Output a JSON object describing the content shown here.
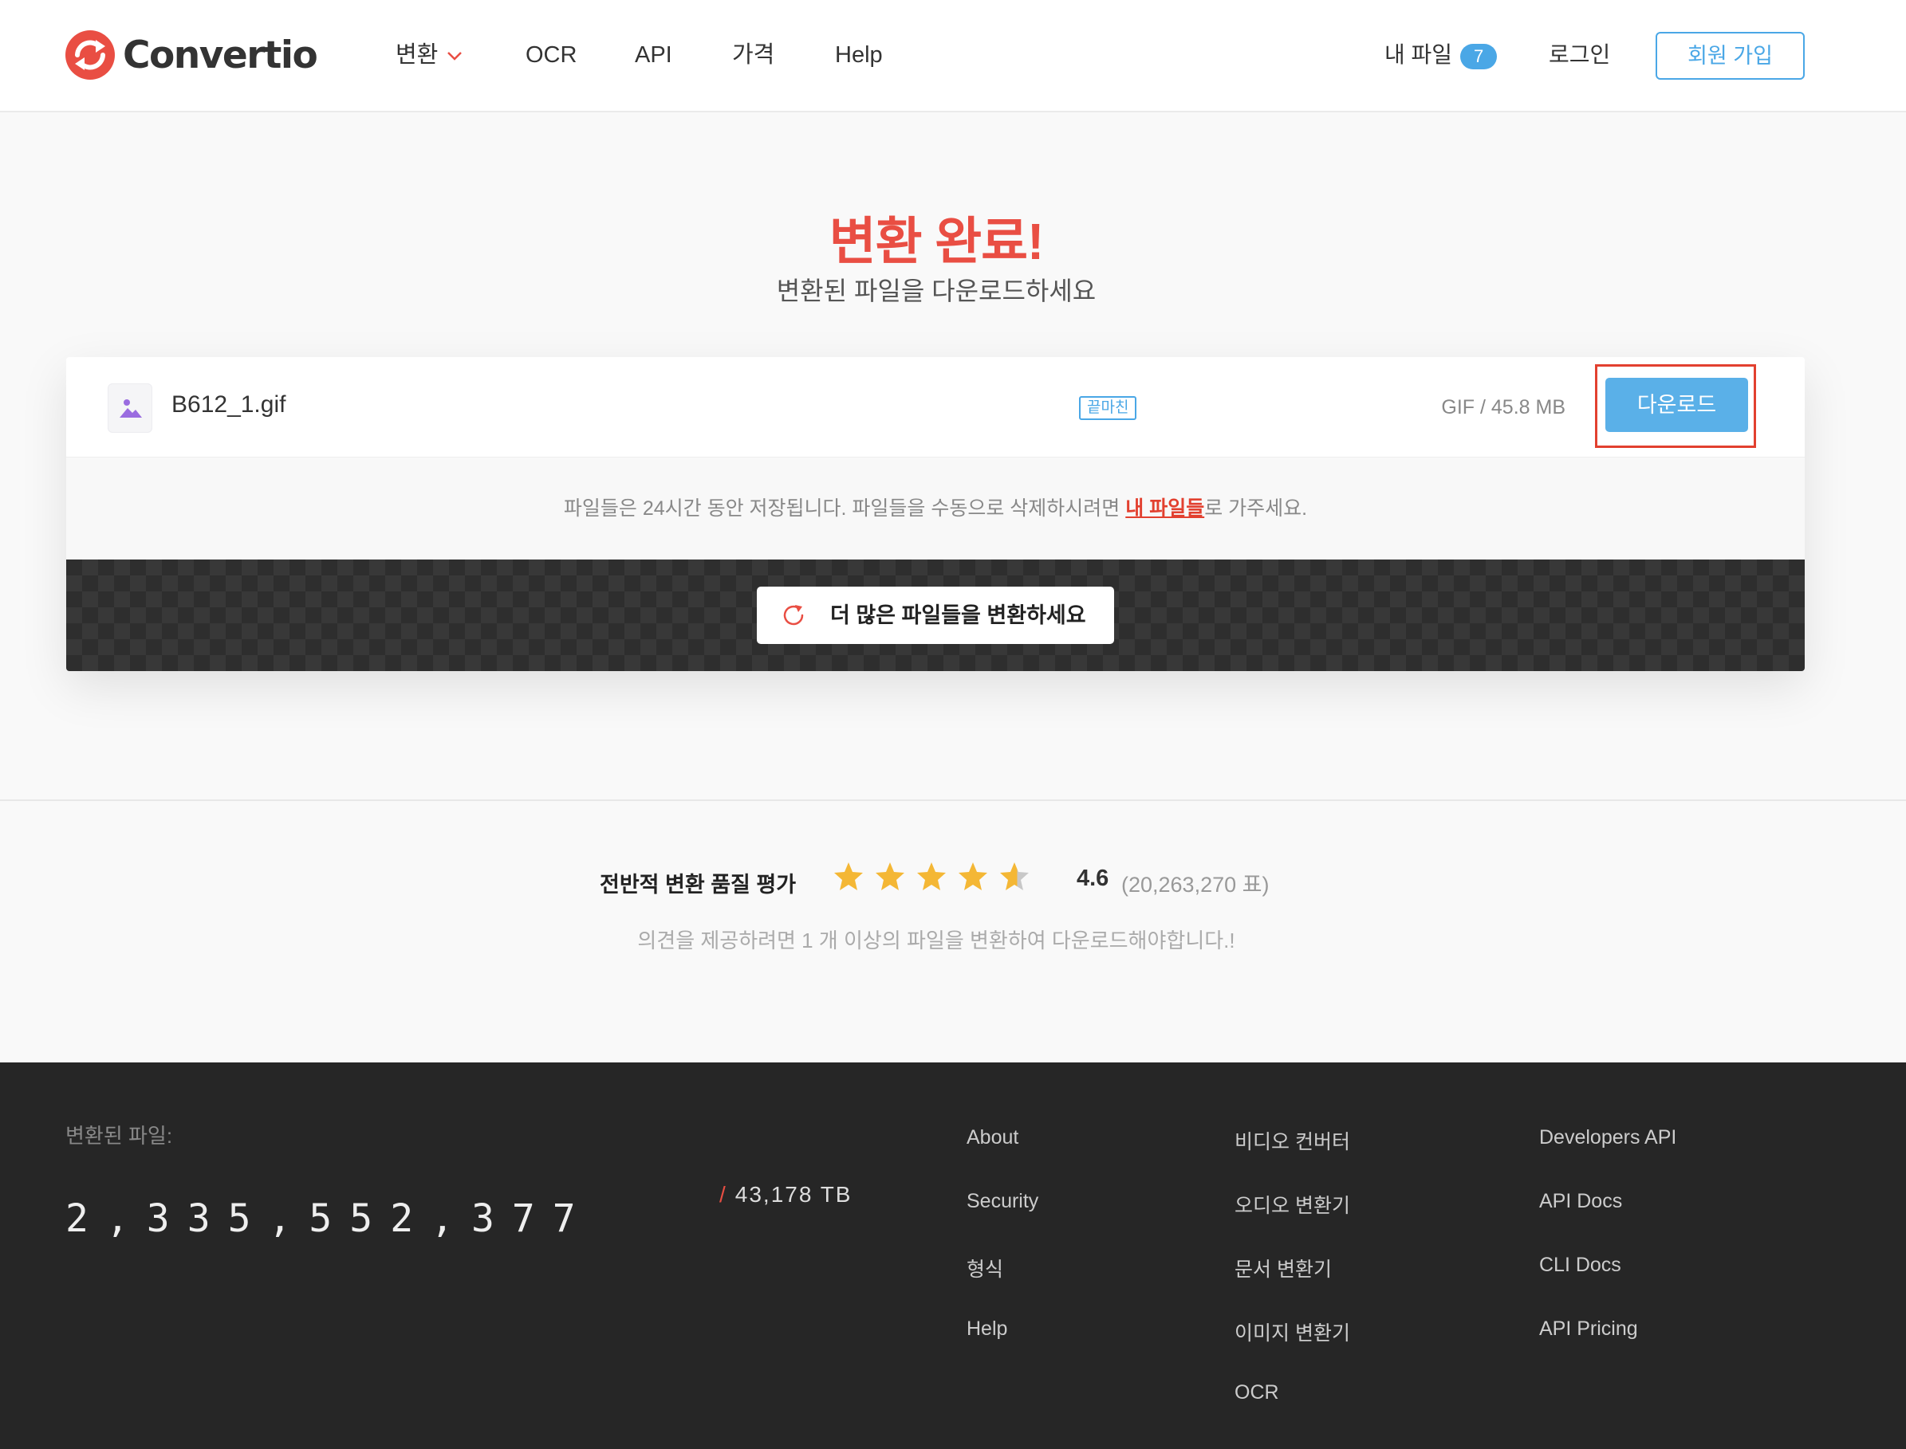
{
  "brand": {
    "name": "Convertio",
    "accent": "#e94e43",
    "blue": "#4aa7e6"
  },
  "nav": {
    "items": [
      {
        "label": "변환"
      },
      {
        "label": "OCR"
      },
      {
        "label": "API"
      },
      {
        "label": "가격"
      },
      {
        "label": "Help"
      }
    ],
    "my_files_label": "내 파일",
    "my_files_count": "7",
    "login_label": "로그인",
    "signup_label": "회원 가입"
  },
  "hero": {
    "title": "변환 완료!",
    "subtitle": "변환된 파일을 다운로드하세요"
  },
  "file": {
    "name": "B612_1.gif",
    "status": "끝마친",
    "meta": "GIF / 45.8 MB",
    "download_label": "다운로드"
  },
  "notice": {
    "before": "파일들은 24시간 동안 저장됩니다. 파일들을 수동으로 삭제하시려면 ",
    "link": "내 파일들",
    "after": "로 가주세요."
  },
  "convert_more_label": "더 많은 파일들을 변환하세요",
  "rating": {
    "label": "전반적 변환 품질 평가",
    "score": "4.6",
    "stars": 4.6,
    "votes": "(20,263,270 표)",
    "hint": "의견을 제공하려면 1 개 이상의 파일을 변환하여 다운로드해야합니다.!"
  },
  "footer": {
    "counter_label": "변환된 파일:",
    "counter_value": "2,335,552,377",
    "tb_value": "43,178 TB",
    "col1": [
      "About",
      "Security",
      "형식",
      "Help"
    ],
    "col2": [
      "비디오 컨버터",
      "오디오 변환기",
      "문서 변환기",
      "이미지 변환기",
      "OCR"
    ],
    "col3": [
      "Developers API",
      "API Docs",
      "CLI Docs",
      "API Pricing"
    ]
  }
}
